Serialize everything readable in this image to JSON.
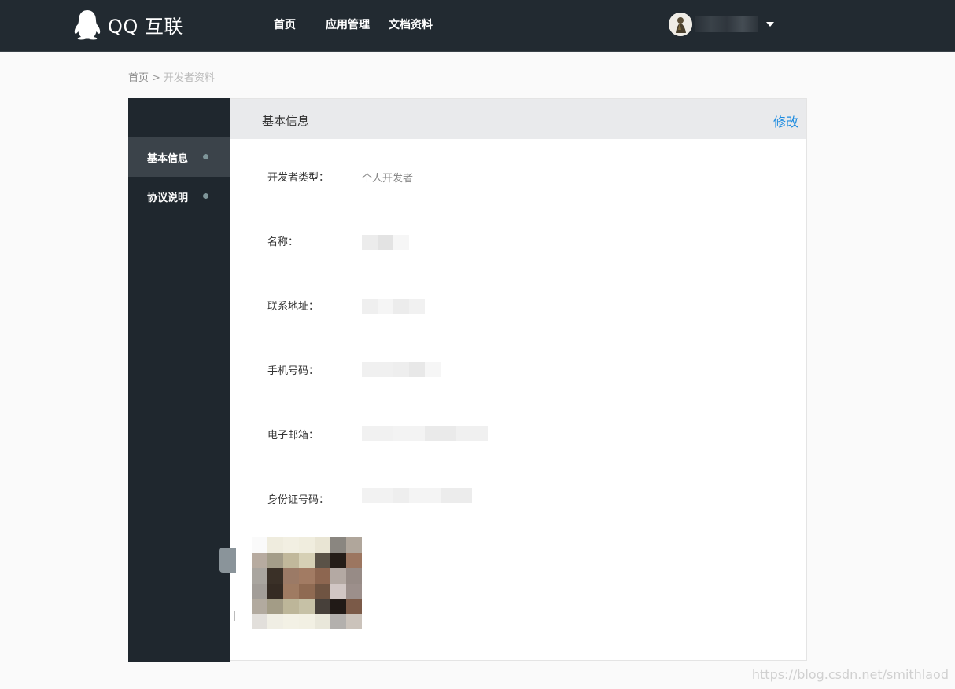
{
  "topbar": {
    "logo_text": "QQ 互联",
    "nav": [
      "首页",
      "应用管理",
      "文档资料"
    ]
  },
  "breadcrumb": {
    "home": "首页",
    "separator": ">",
    "current": "开发者资料"
  },
  "sidebar": {
    "items": [
      {
        "label": "基本信息",
        "active": true
      },
      {
        "label": "协议说明",
        "active": false
      }
    ]
  },
  "panel": {
    "title": "基本信息",
    "edit_label": "修改",
    "fields": [
      {
        "label": "开发者类型：",
        "value": "个人开发者"
      },
      {
        "label": "名称：",
        "value": ""
      },
      {
        "label": "联系地址：",
        "value": ""
      },
      {
        "label": "手机号码：",
        "value": ""
      },
      {
        "label": "电子邮箱：",
        "value": ""
      },
      {
        "label": "身份证号码：",
        "value": ""
      }
    ]
  },
  "watermark": "https://blog.csdn.net/smithlaod",
  "colors": {
    "topbar_bg": "#222a31",
    "sidebar_bg": "#1f272e",
    "sidebar_active": "#3b434a",
    "link": "#1e8ce0"
  }
}
